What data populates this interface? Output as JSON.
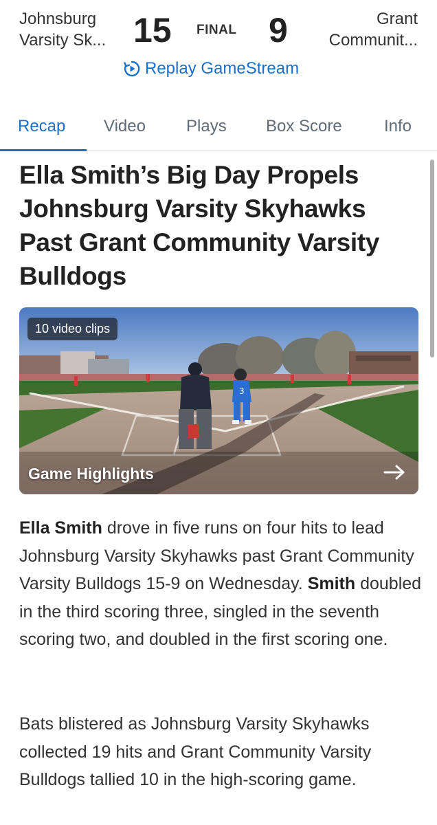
{
  "scoreboard": {
    "home_team_line1": "Johnsburg",
    "home_team_line2": "Varsity Sk...",
    "home_score": "15",
    "status": "FINAL",
    "away_score": "9",
    "away_team_line1": "Grant",
    "away_team_line2": "Communit...",
    "replay_label": "Replay GameStream"
  },
  "tabs": [
    {
      "label": "Recap",
      "active": true
    },
    {
      "label": "Video",
      "active": false
    },
    {
      "label": "Plays",
      "active": false
    },
    {
      "label": "Box Score",
      "active": false
    },
    {
      "label": "Info",
      "active": false
    }
  ],
  "article": {
    "headline": "Ella Smith’s Big Day Propels Johnsburg Varsity Skyhawks Past Grant Community Varsity Bulldogs",
    "video": {
      "clips_badge": "10 video clips",
      "title": "Game Highlights",
      "arrow_icon": "arrow-right-icon"
    },
    "p1": {
      "bold1": "Ella Smith",
      "text1": " drove in five runs on four hits to lead Johnsburg Varsity Skyhawks past Grant Community Varsity Bulldogs 15-9 on Wednesday. ",
      "bold2": "Smith",
      "text2": " doubled in the third scoring three, singled in the seventh scoring two, and doubled in the first scoring one."
    },
    "p2": "Bats blistered as Johnsburg Varsity Skyhawks collected 19 hits and Grant Community Varsity Bulldogs tallied 10 in the high-scoring game."
  },
  "colors": {
    "accent": "#1a6fc9",
    "tab_inactive": "#606b78"
  }
}
